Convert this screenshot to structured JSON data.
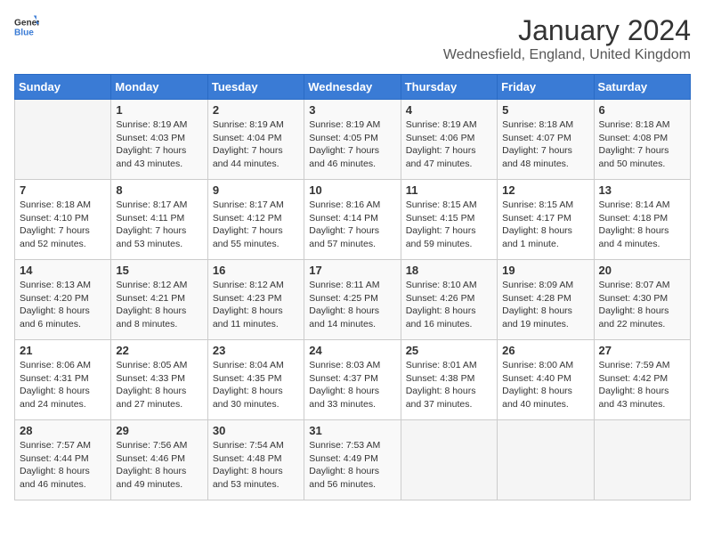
{
  "logo": {
    "general": "General",
    "blue": "Blue"
  },
  "header": {
    "title": "January 2024",
    "subtitle": "Wednesfield, England, United Kingdom"
  },
  "weekdays": [
    "Sunday",
    "Monday",
    "Tuesday",
    "Wednesday",
    "Thursday",
    "Friday",
    "Saturday"
  ],
  "weeks": [
    [
      {
        "day": "",
        "info": []
      },
      {
        "day": "1",
        "info": [
          "Sunrise: 8:19 AM",
          "Sunset: 4:03 PM",
          "Daylight: 7 hours",
          "and 43 minutes."
        ]
      },
      {
        "day": "2",
        "info": [
          "Sunrise: 8:19 AM",
          "Sunset: 4:04 PM",
          "Daylight: 7 hours",
          "and 44 minutes."
        ]
      },
      {
        "day": "3",
        "info": [
          "Sunrise: 8:19 AM",
          "Sunset: 4:05 PM",
          "Daylight: 7 hours",
          "and 46 minutes."
        ]
      },
      {
        "day": "4",
        "info": [
          "Sunrise: 8:19 AM",
          "Sunset: 4:06 PM",
          "Daylight: 7 hours",
          "and 47 minutes."
        ]
      },
      {
        "day": "5",
        "info": [
          "Sunrise: 8:18 AM",
          "Sunset: 4:07 PM",
          "Daylight: 7 hours",
          "and 48 minutes."
        ]
      },
      {
        "day": "6",
        "info": [
          "Sunrise: 8:18 AM",
          "Sunset: 4:08 PM",
          "Daylight: 7 hours",
          "and 50 minutes."
        ]
      }
    ],
    [
      {
        "day": "7",
        "info": [
          "Sunrise: 8:18 AM",
          "Sunset: 4:10 PM",
          "Daylight: 7 hours",
          "and 52 minutes."
        ]
      },
      {
        "day": "8",
        "info": [
          "Sunrise: 8:17 AM",
          "Sunset: 4:11 PM",
          "Daylight: 7 hours",
          "and 53 minutes."
        ]
      },
      {
        "day": "9",
        "info": [
          "Sunrise: 8:17 AM",
          "Sunset: 4:12 PM",
          "Daylight: 7 hours",
          "and 55 minutes."
        ]
      },
      {
        "day": "10",
        "info": [
          "Sunrise: 8:16 AM",
          "Sunset: 4:14 PM",
          "Daylight: 7 hours",
          "and 57 minutes."
        ]
      },
      {
        "day": "11",
        "info": [
          "Sunrise: 8:15 AM",
          "Sunset: 4:15 PM",
          "Daylight: 7 hours",
          "and 59 minutes."
        ]
      },
      {
        "day": "12",
        "info": [
          "Sunrise: 8:15 AM",
          "Sunset: 4:17 PM",
          "Daylight: 8 hours",
          "and 1 minute."
        ]
      },
      {
        "day": "13",
        "info": [
          "Sunrise: 8:14 AM",
          "Sunset: 4:18 PM",
          "Daylight: 8 hours",
          "and 4 minutes."
        ]
      }
    ],
    [
      {
        "day": "14",
        "info": [
          "Sunrise: 8:13 AM",
          "Sunset: 4:20 PM",
          "Daylight: 8 hours",
          "and 6 minutes."
        ]
      },
      {
        "day": "15",
        "info": [
          "Sunrise: 8:12 AM",
          "Sunset: 4:21 PM",
          "Daylight: 8 hours",
          "and 8 minutes."
        ]
      },
      {
        "day": "16",
        "info": [
          "Sunrise: 8:12 AM",
          "Sunset: 4:23 PM",
          "Daylight: 8 hours",
          "and 11 minutes."
        ]
      },
      {
        "day": "17",
        "info": [
          "Sunrise: 8:11 AM",
          "Sunset: 4:25 PM",
          "Daylight: 8 hours",
          "and 14 minutes."
        ]
      },
      {
        "day": "18",
        "info": [
          "Sunrise: 8:10 AM",
          "Sunset: 4:26 PM",
          "Daylight: 8 hours",
          "and 16 minutes."
        ]
      },
      {
        "day": "19",
        "info": [
          "Sunrise: 8:09 AM",
          "Sunset: 4:28 PM",
          "Daylight: 8 hours",
          "and 19 minutes."
        ]
      },
      {
        "day": "20",
        "info": [
          "Sunrise: 8:07 AM",
          "Sunset: 4:30 PM",
          "Daylight: 8 hours",
          "and 22 minutes."
        ]
      }
    ],
    [
      {
        "day": "21",
        "info": [
          "Sunrise: 8:06 AM",
          "Sunset: 4:31 PM",
          "Daylight: 8 hours",
          "and 24 minutes."
        ]
      },
      {
        "day": "22",
        "info": [
          "Sunrise: 8:05 AM",
          "Sunset: 4:33 PM",
          "Daylight: 8 hours",
          "and 27 minutes."
        ]
      },
      {
        "day": "23",
        "info": [
          "Sunrise: 8:04 AM",
          "Sunset: 4:35 PM",
          "Daylight: 8 hours",
          "and 30 minutes."
        ]
      },
      {
        "day": "24",
        "info": [
          "Sunrise: 8:03 AM",
          "Sunset: 4:37 PM",
          "Daylight: 8 hours",
          "and 33 minutes."
        ]
      },
      {
        "day": "25",
        "info": [
          "Sunrise: 8:01 AM",
          "Sunset: 4:38 PM",
          "Daylight: 8 hours",
          "and 37 minutes."
        ]
      },
      {
        "day": "26",
        "info": [
          "Sunrise: 8:00 AM",
          "Sunset: 4:40 PM",
          "Daylight: 8 hours",
          "and 40 minutes."
        ]
      },
      {
        "day": "27",
        "info": [
          "Sunrise: 7:59 AM",
          "Sunset: 4:42 PM",
          "Daylight: 8 hours",
          "and 43 minutes."
        ]
      }
    ],
    [
      {
        "day": "28",
        "info": [
          "Sunrise: 7:57 AM",
          "Sunset: 4:44 PM",
          "Daylight: 8 hours",
          "and 46 minutes."
        ]
      },
      {
        "day": "29",
        "info": [
          "Sunrise: 7:56 AM",
          "Sunset: 4:46 PM",
          "Daylight: 8 hours",
          "and 49 minutes."
        ]
      },
      {
        "day": "30",
        "info": [
          "Sunrise: 7:54 AM",
          "Sunset: 4:48 PM",
          "Daylight: 8 hours",
          "and 53 minutes."
        ]
      },
      {
        "day": "31",
        "info": [
          "Sunrise: 7:53 AM",
          "Sunset: 4:49 PM",
          "Daylight: 8 hours",
          "and 56 minutes."
        ]
      },
      {
        "day": "",
        "info": []
      },
      {
        "day": "",
        "info": []
      },
      {
        "day": "",
        "info": []
      }
    ]
  ]
}
